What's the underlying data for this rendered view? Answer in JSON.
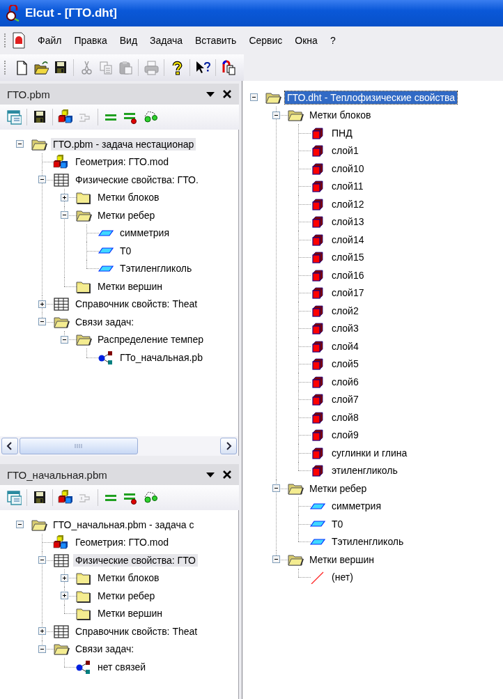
{
  "window": {
    "title": "Elcut - [ГТО.dht]"
  },
  "menu": {
    "items": [
      "Файл",
      "Правка",
      "Вид",
      "Задача",
      "Вставить",
      "Сервис",
      "Окна",
      "?"
    ]
  },
  "toolbar": {
    "groups": [
      [
        {
          "kind": "new",
          "disabled": false
        },
        {
          "kind": "open",
          "disabled": false
        },
        {
          "kind": "save",
          "disabled": false
        }
      ],
      [
        {
          "kind": "cut",
          "disabled": true
        },
        {
          "kind": "copy",
          "disabled": true
        },
        {
          "kind": "paste",
          "disabled": true
        }
      ],
      [
        {
          "kind": "print",
          "disabled": true
        }
      ],
      [
        {
          "kind": "help",
          "disabled": false
        }
      ],
      [
        {
          "kind": "context-help",
          "disabled": false
        }
      ],
      [
        {
          "kind": "windows",
          "disabled": false
        }
      ]
    ]
  },
  "panes": [
    {
      "title": "ГТО.pbm",
      "focused": false,
      "toolbar": [
        [
          {
            "kind": "properties",
            "disabled": false
          }
        ],
        [
          {
            "kind": "save",
            "disabled": false
          }
        ],
        [
          {
            "kind": "geometry",
            "disabled": false
          },
          {
            "kind": "connector",
            "disabled": true
          }
        ],
        [
          {
            "kind": "equals",
            "disabled": false
          },
          {
            "kind": "equals-dot",
            "disabled": false
          },
          {
            "kind": "link-nodes",
            "disabled": false
          }
        ]
      ],
      "tree": [
        {
          "label": "ГТО.pbm - задача нестационар",
          "kind": "folder-open",
          "expanded": true,
          "selected": true,
          "children": [
            {
              "label": "Геометрия: ГТО.mod",
              "kind": "geometry",
              "selected": false
            },
            {
              "label": "Физические свойства: ГТО.",
              "kind": "table",
              "expanded": true,
              "selected": false,
              "children": [
                {
                  "label": "Метки блоков",
                  "kind": "folder",
                  "expanded": false,
                  "selected": false
                },
                {
                  "label": "Метки ребер",
                  "kind": "folder-open",
                  "expanded": true,
                  "selected": false,
                  "children": [
                    {
                      "label": "симметрия",
                      "kind": "edge",
                      "selected": false
                    },
                    {
                      "label": "T0",
                      "kind": "edge",
                      "selected": false
                    },
                    {
                      "label": "Тэтиленгликоль",
                      "kind": "edge",
                      "selected": false
                    }
                  ]
                },
                {
                  "label": "Метки вершин",
                  "kind": "folder",
                  "selected": false
                }
              ]
            },
            {
              "label": "Справочник свойств: Theat",
              "kind": "table",
              "expanded": false,
              "selected": false
            },
            {
              "label": "Связи задач:",
              "kind": "folder-open",
              "expanded": true,
              "selected": false,
              "children": [
                {
                  "label": "Распределение темпер",
                  "kind": "folder-open",
                  "expanded": true,
                  "selected": false,
                  "children": [
                    {
                      "label": "ГТо_начальная.pb",
                      "kind": "link",
                      "selected": false
                    }
                  ]
                }
              ]
            }
          ]
        }
      ]
    },
    {
      "title": "ГТО_начальная.pbm",
      "focused": false,
      "toolbar": [
        [
          {
            "kind": "properties",
            "disabled": false
          }
        ],
        [
          {
            "kind": "save",
            "disabled": false
          }
        ],
        [
          {
            "kind": "geometry",
            "disabled": false
          },
          {
            "kind": "connector",
            "disabled": true
          }
        ],
        [
          {
            "kind": "equals",
            "disabled": false
          },
          {
            "kind": "equals-dot",
            "disabled": false
          },
          {
            "kind": "link-nodes",
            "disabled": false
          }
        ]
      ],
      "tree": [
        {
          "label": "ГТО_начальная.pbm - задача с",
          "kind": "folder-open",
          "expanded": true,
          "selected": false,
          "children": [
            {
              "label": "Геометрия: ГТО.mod",
              "kind": "geometry",
              "selected": false
            },
            {
              "label": "Физические свойства: ГТО",
              "kind": "table",
              "expanded": true,
              "selected": true,
              "children": [
                {
                  "label": "Метки блоков",
                  "kind": "folder",
                  "expanded": false,
                  "selected": false
                },
                {
                  "label": "Метки ребер",
                  "kind": "folder",
                  "expanded": false,
                  "selected": false
                },
                {
                  "label": "Метки вершин",
                  "kind": "folder",
                  "selected": false
                }
              ]
            },
            {
              "label": "Справочник свойств: Theat",
              "kind": "table",
              "expanded": false,
              "selected": false
            },
            {
              "label": "Связи задач:",
              "kind": "folder-open",
              "expanded": true,
              "selected": false,
              "children": [
                {
                  "label": "нет связей",
                  "kind": "link",
                  "selected": false
                }
              ]
            }
          ]
        }
      ]
    }
  ],
  "editor": {
    "focused": true,
    "tree": [
      {
        "label": "ГТО.dht - Теплофизические свойства",
        "kind": "folder-open",
        "expanded": true,
        "selected": true,
        "children": [
          {
            "label": "Метки блоков",
            "kind": "folder-open",
            "expanded": true,
            "selected": false,
            "children": [
              {
                "label": "ПНД",
                "kind": "block",
                "selected": false
              },
              {
                "label": "слой1",
                "kind": "block",
                "selected": false
              },
              {
                "label": "слой10",
                "kind": "block",
                "selected": false
              },
              {
                "label": "слой11",
                "kind": "block",
                "selected": false
              },
              {
                "label": "слой12",
                "kind": "block",
                "selected": false
              },
              {
                "label": "слой13",
                "kind": "block",
                "selected": false
              },
              {
                "label": "слой14",
                "kind": "block",
                "selected": false
              },
              {
                "label": "слой15",
                "kind": "block",
                "selected": false
              },
              {
                "label": "слой16",
                "kind": "block",
                "selected": false
              },
              {
                "label": "слой17",
                "kind": "block",
                "selected": false
              },
              {
                "label": "слой2",
                "kind": "block",
                "selected": false
              },
              {
                "label": "слой3",
                "kind": "block",
                "selected": false
              },
              {
                "label": "слой4",
                "kind": "block",
                "selected": false
              },
              {
                "label": "слой5",
                "kind": "block",
                "selected": false
              },
              {
                "label": "слой6",
                "kind": "block",
                "selected": false
              },
              {
                "label": "слой7",
                "kind": "block",
                "selected": false
              },
              {
                "label": "слой8",
                "kind": "block",
                "selected": false
              },
              {
                "label": "слой9",
                "kind": "block",
                "selected": false
              },
              {
                "label": "суглинки и глина",
                "kind": "block",
                "selected": false
              },
              {
                "label": "этиленгликоль",
                "kind": "block",
                "selected": false
              }
            ]
          },
          {
            "label": "Метки ребер",
            "kind": "folder-open",
            "expanded": true,
            "selected": false,
            "children": [
              {
                "label": "симметрия",
                "kind": "edge",
                "selected": false
              },
              {
                "label": "T0",
                "kind": "edge",
                "selected": false
              },
              {
                "label": "Тэтиленгликоль",
                "kind": "edge",
                "selected": false
              }
            ]
          },
          {
            "label": "Метки вершин",
            "kind": "folder-open",
            "expanded": true,
            "selected": false,
            "children": [
              {
                "label": "(нет)",
                "kind": "vertex",
                "selected": false
              }
            ]
          }
        ]
      }
    ]
  }
}
